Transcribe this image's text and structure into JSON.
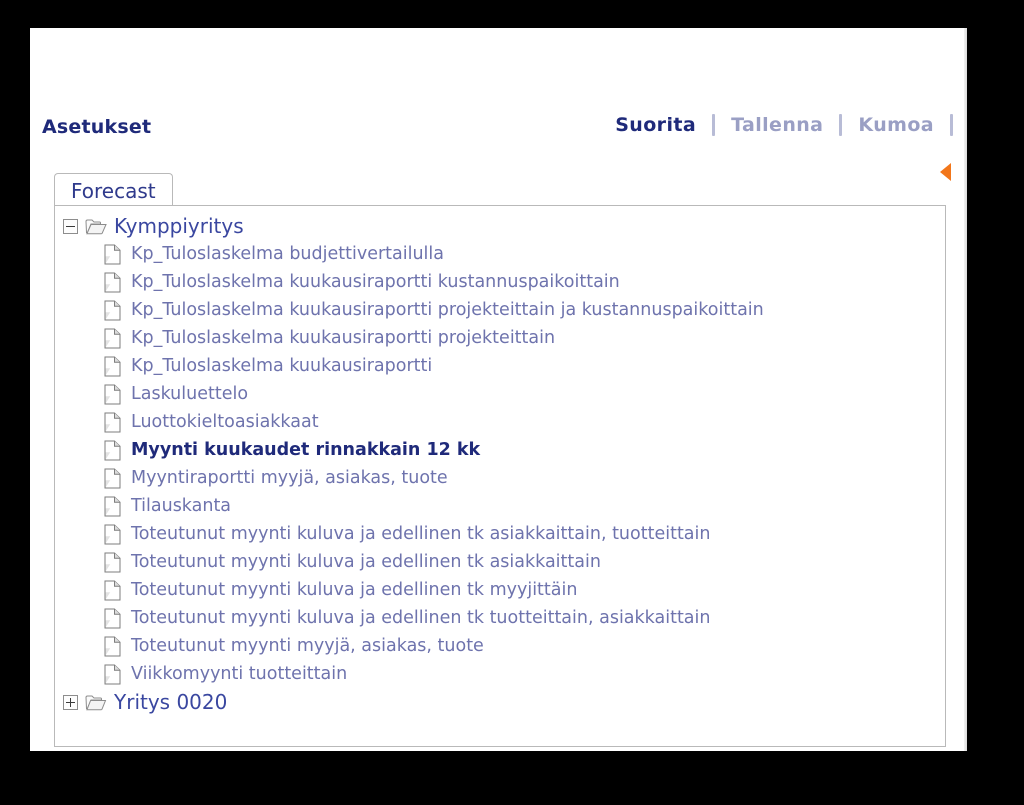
{
  "page": {
    "title": "Asetukset"
  },
  "toolbar": {
    "actions": [
      {
        "label": "Suorita",
        "enabled": true
      },
      {
        "label": "Tallenna",
        "enabled": false
      },
      {
        "label": "Kumoa",
        "enabled": false
      }
    ]
  },
  "tabs": [
    {
      "label": "Forecast",
      "active": true
    }
  ],
  "tree": {
    "nodes": [
      {
        "label": "Kymppiyritys",
        "icon": "folder-open-icon",
        "expanded": true,
        "expander": "minus",
        "children": [
          {
            "label": "Kp_Tuloslaskelma budjettivertailulla",
            "icon": "document-icon",
            "selected": false
          },
          {
            "label": "Kp_Tuloslaskelma kuukausiraportti kustannuspaikoittain",
            "icon": "document-icon",
            "selected": false
          },
          {
            "label": "Kp_Tuloslaskelma kuukausiraportti projekteittain ja kustannuspaikoittain",
            "icon": "document-icon",
            "selected": false
          },
          {
            "label": "Kp_Tuloslaskelma kuukausiraportti projekteittain",
            "icon": "document-icon",
            "selected": false
          },
          {
            "label": "Kp_Tuloslaskelma kuukausiraportti",
            "icon": "document-icon",
            "selected": false
          },
          {
            "label": "Laskuluettelo",
            "icon": "document-icon",
            "selected": false
          },
          {
            "label": "Luottokieltoasiakkaat",
            "icon": "document-icon",
            "selected": false
          },
          {
            "label": "Myynti kuukaudet rinnakkain 12 kk",
            "icon": "document-icon",
            "selected": true
          },
          {
            "label": "Myyntiraportti myyjä, asiakas, tuote",
            "icon": "document-icon",
            "selected": false
          },
          {
            "label": "Tilauskanta",
            "icon": "document-icon",
            "selected": false
          },
          {
            "label": "Toteutunut myynti kuluva ja edellinen tk asiakkaittain, tuotteittain",
            "icon": "document-icon",
            "selected": false
          },
          {
            "label": "Toteutunut myynti kuluva ja edellinen tk asiakkaittain",
            "icon": "document-icon",
            "selected": false
          },
          {
            "label": "Toteutunut myynti kuluva ja edellinen tk myyjittäin",
            "icon": "document-icon",
            "selected": false
          },
          {
            "label": "Toteutunut myynti kuluva ja edellinen tk tuotteittain, asiakkaittain",
            "icon": "document-icon",
            "selected": false
          },
          {
            "label": "Toteutunut myynti myyjä, asiakas, tuote",
            "icon": "document-icon",
            "selected": false
          },
          {
            "label": "Viikkomyynti tuotteittain",
            "icon": "document-icon",
            "selected": false
          }
        ]
      },
      {
        "label": "Yritys 0020",
        "icon": "folder-closed-icon",
        "expanded": false,
        "expander": "plus",
        "children": []
      }
    ]
  },
  "panel_handle": {
    "icon": "collapse-left-triangle-icon",
    "color": "#f2761a"
  },
  "colors": {
    "accent_title": "#1f2a7a",
    "node_text": "#3a47a0",
    "leaf_text": "#6e73ad",
    "disabled_action": "#9a9fc4",
    "border": "#b9b9b9",
    "handle_orange": "#f2761a"
  }
}
